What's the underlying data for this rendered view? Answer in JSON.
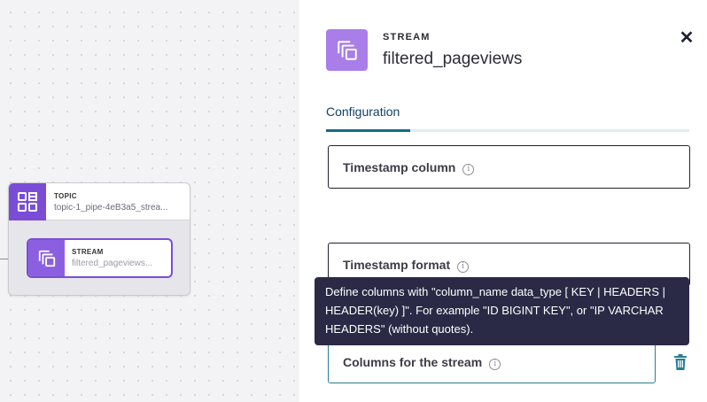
{
  "canvas": {
    "topic_node": {
      "kind": "TOPIC",
      "name": "topic-1_pipe-4eB3a5_strea..."
    },
    "stream_node": {
      "kind": "STREAM",
      "name": "filtered_pageviews..."
    }
  },
  "panel": {
    "kind": "STREAM",
    "title": "filtered_pageviews",
    "close_icon": "✕",
    "tabs": [
      {
        "label": "Configuration",
        "active": true
      }
    ],
    "fields": [
      {
        "label": "Timestamp column",
        "info_icon": "i"
      },
      {
        "label": "Timestamp format",
        "info_icon": "i"
      },
      {
        "label": "Columns for the stream",
        "info_icon": "i"
      }
    ]
  },
  "tooltip": {
    "text": "Define columns with \"column_name data_type [ KEY | HEADERS | HEADER(key) ]\". For example \"ID BIGINT KEY\", or \"IP VARCHAR HEADERS\" (without quotes)."
  },
  "colors": {
    "accent_purple": "#7b4dd6",
    "panel_icon_purple": "#a97ee8",
    "tab_active": "#146c85",
    "tooltip_bg": "#2a2a46",
    "trash": "#2a7d93"
  }
}
